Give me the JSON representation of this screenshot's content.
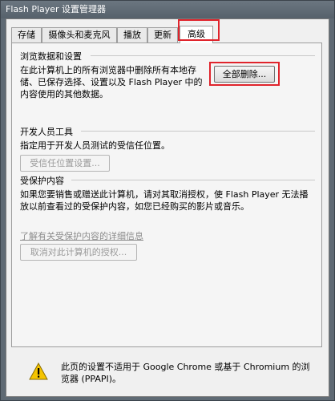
{
  "window": {
    "title": "Flash Player 设置管理器"
  },
  "tabs": [
    {
      "label": "存储"
    },
    {
      "label": "摄像头和麦克风"
    },
    {
      "label": "播放"
    },
    {
      "label": "更新"
    },
    {
      "label": "高级"
    }
  ],
  "browsing": {
    "title": "浏览数据和设置",
    "description": "在此计算机上的所有浏览器中删除所有本地存储、已保存选择、设置以及 Flash Player 中的内容使用的其他数据。",
    "delete_all_button": "全部删除..."
  },
  "developer": {
    "title": "开发人员工具",
    "description": "指定用于开发人员测试的受信任位置。",
    "trusted_location_button": "受信任位置设置..."
  },
  "protected_content": {
    "title": "受保护内容",
    "description": "如果您要销售或赠送此计算机，请对其取消授权，使 Flash Player 无法播放以前查看过的受保护内容，如您已经购买的影片或音乐。",
    "learn_more_link": "了解有关受保护内容的详细信息",
    "deauthorize_button": "取消对此计算机的授权..."
  },
  "footer": {
    "warning_text": "此页的设置不适用于 Google Chrome 或基于 Chromium 的浏览器 (PPAPI)。",
    "icon": "warning-icon"
  }
}
